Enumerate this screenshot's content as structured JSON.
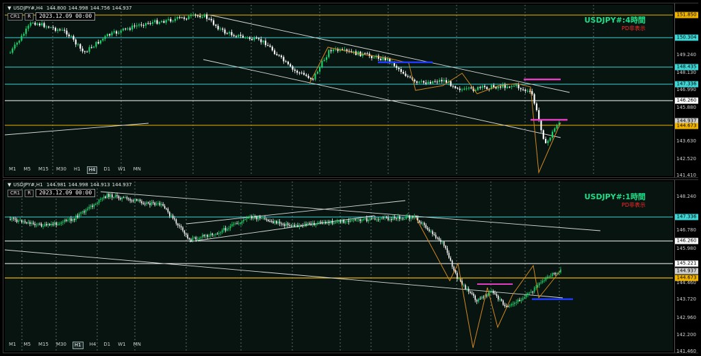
{
  "panels": [
    {
      "symbol": "USDJPY#,H4",
      "ohlc": [
        "144.800",
        "144.998",
        "144.756",
        "144.937"
      ],
      "chart_label": "CR1",
      "r_button": "R",
      "datetime": "2023.12.09 00:00",
      "title": "USDJPY#:4時間",
      "pd_label": "PD非表示",
      "timeframes": [
        "M1",
        "M5",
        "M15",
        "M30",
        "H1",
        "H4",
        "D1",
        "W1",
        "MN"
      ],
      "active_timeframe": "H4",
      "price_axis": [
        "151.850",
        "150.304",
        "149.240",
        "148.435",
        "148.130",
        "147.336",
        "146.990",
        "146.260",
        "145.880",
        "144.937",
        "144.673",
        "143.630",
        "142.520",
        "141.410"
      ],
      "price_labels": [
        {
          "text": "151.850",
          "kind": "orange"
        },
        {
          "text": "150.304",
          "kind": "cyan"
        },
        {
          "text": "148.435",
          "kind": "cyan"
        },
        {
          "text": "147.336",
          "kind": "cyan"
        },
        {
          "text": "146.260",
          "kind": "white"
        },
        {
          "text": "144.937",
          "kind": "gray"
        },
        {
          "text": "144.673",
          "kind": "orange"
        }
      ]
    },
    {
      "symbol": "USDJPY#,H1",
      "ohlc": [
        "144.981",
        "144.998",
        "144.913",
        "144.937"
      ],
      "chart_label": "CR1",
      "r_button": "R",
      "datetime": "2023.12.09 00:00",
      "title": "USDJPY#:1時間",
      "pd_label": "PD非表示",
      "timeframes": [
        "M1",
        "M5",
        "M15",
        "M30",
        "H1",
        "H4",
        "D1",
        "W1",
        "MN"
      ],
      "active_timeframe": "H1",
      "price_axis": [
        "148.240",
        "147.336",
        "146.780",
        "146.260",
        "145.980",
        "145.221",
        "144.937",
        "144.673",
        "144.460",
        "143.720",
        "142.960",
        "142.200",
        "141.460"
      ],
      "price_labels": [
        {
          "text": "147.336",
          "kind": "cyan"
        },
        {
          "text": "146.260",
          "kind": "white"
        },
        {
          "text": "145.221",
          "kind": "white"
        },
        {
          "text": "144.937",
          "kind": "gray"
        },
        {
          "text": "144.673",
          "kind": "orange"
        }
      ]
    }
  ],
  "colors": {
    "bull": "#19d36b",
    "bear": "#ffffff",
    "cyan": "#3fd6d6",
    "orange": "#f0b400",
    "zigzag": "#d4891f",
    "magenta": "#e63fc4",
    "blue": "#1f3cff",
    "title": "#19e089",
    "pd": "#ff2a2a"
  },
  "icons": [
    "dropdown-triangle-icon"
  ]
}
